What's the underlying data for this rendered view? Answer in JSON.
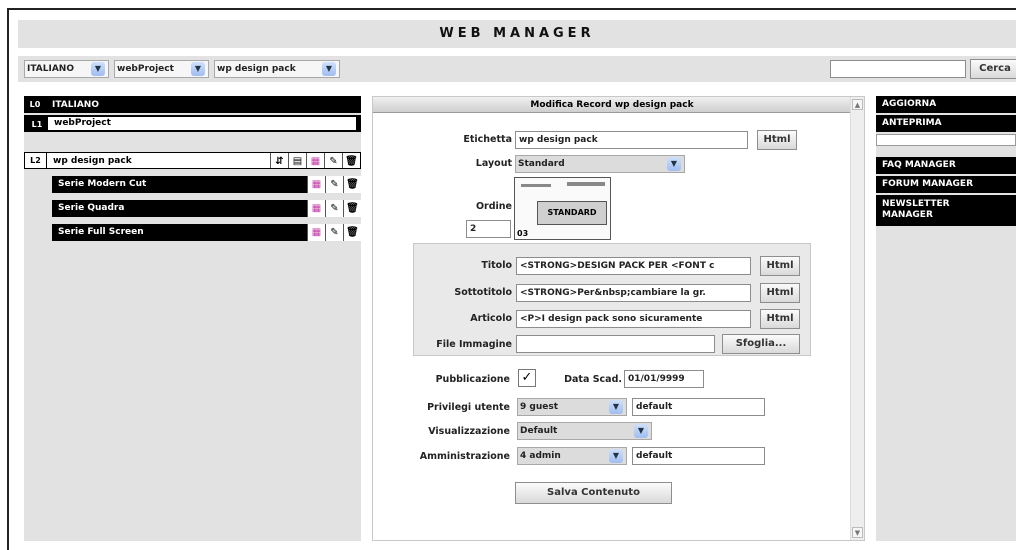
{
  "app_title": "WEB MANAGER",
  "topbar": {
    "lang_select": "ITALIANO",
    "project_select": "webProject",
    "pack_select": "wp design pack",
    "search_value": "",
    "search_button": "Cerca"
  },
  "tree": {
    "l0": {
      "level": "L0",
      "label": "ITALIANO"
    },
    "l1": {
      "level": "L1",
      "label": "webProject"
    },
    "l2": {
      "level": "L2",
      "label": "wp design pack"
    },
    "children": [
      "Serie Modern Cut",
      "Serie Quadra",
      "Serie Full Screen"
    ]
  },
  "editor": {
    "header": "Modifica Record wp design pack",
    "etichetta_label": "Etichetta",
    "etichetta_value": "wp design pack",
    "html_button": "Html",
    "layout_label": "Layout",
    "layout_value": "Standard",
    "ordine_label": "Ordine",
    "ordine_value": "2",
    "preview_label": "STANDARD",
    "preview_code": "03",
    "titolo_label": "Titolo",
    "titolo_value": "<STRONG>DESIGN PACK PER <FONT c",
    "sottotitolo_label": "Sottotitolo",
    "sottotitolo_value": "<STRONG>Per&nbsp;cambiare la gr.",
    "articolo_label": "Articolo",
    "articolo_value": "<P>I design pack sono sicuramente",
    "file_label": "File Immagine",
    "file_value": "",
    "sfoglia_button": "Sfoglia...",
    "pubblicazione_label": "Pubblicazione",
    "pubblicazione_checked": true,
    "scadenza_label": "Data Scad.",
    "scadenza_value": "01/01/9999",
    "privilegi_label": "Privilegi utente",
    "privilegi_value": "9 guest",
    "privilegi_text": "default",
    "visualizzazione_label": "Visualizzazione",
    "visualizzazione_value": "Default",
    "amministrazione_label": "Amministrazione",
    "amministrazione_value": "4 admin",
    "amministrazione_text": "default",
    "save_button": "Salva Contenuto"
  },
  "right_menu": {
    "aggiorna": "AGGIORNA",
    "anteprima": "ANTEPRIMA",
    "faq": "FAQ MANAGER",
    "forum": "FORUM MANAGER",
    "newsletter_1": "NEWSLETTER",
    "newsletter_2": "MANAGER"
  },
  "colors": {
    "panel_gray": "#e2e2e2",
    "bar_black": "#000000",
    "select_arrow": "#9fbdf0",
    "doc_icon": "#c23aa7"
  }
}
